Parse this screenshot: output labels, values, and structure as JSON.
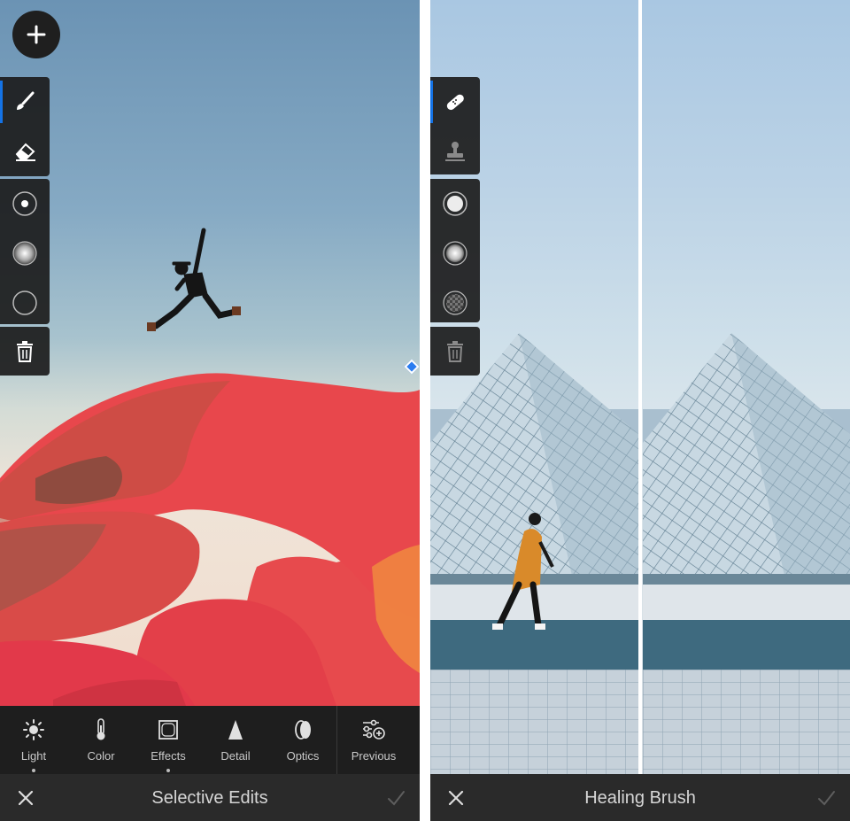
{
  "left_screen": {
    "add_button": "add",
    "brush_tools": [
      {
        "icon": "brush-icon",
        "active": true
      },
      {
        "icon": "eraser-icon",
        "active": false
      }
    ],
    "brush_sizes": [
      {
        "icon": "size-small-icon"
      },
      {
        "icon": "size-feather-icon"
      },
      {
        "icon": "size-empty-icon"
      }
    ],
    "delete": "trash-icon",
    "tabs": [
      {
        "label": "Light",
        "icon": "sun-icon",
        "has_dot": true
      },
      {
        "label": "Color",
        "icon": "thermometer-icon",
        "has_dot": false
      },
      {
        "label": "Effects",
        "icon": "effects-frame-icon",
        "has_dot": true
      },
      {
        "label": "Detail",
        "icon": "detail-triangle-icon",
        "has_dot": false
      },
      {
        "label": "Optics",
        "icon": "optics-lens-icon",
        "has_dot": false
      },
      {
        "label": "Previous",
        "icon": "sliders-plus-icon",
        "has_dot": false
      }
    ],
    "title": "Selective Edits"
  },
  "right_screen": {
    "heal_tools": [
      {
        "icon": "bandage-icon",
        "active": true
      },
      {
        "icon": "stamp-icon",
        "active": false
      }
    ],
    "brush_sizes": [
      {
        "icon": "size-solid-icon"
      },
      {
        "icon": "size-feather-icon"
      },
      {
        "icon": "size-opacity-icon"
      }
    ],
    "delete": "trash-icon",
    "title": "Healing Brush"
  },
  "colors": {
    "accent": "#1473e6",
    "toolbar_bg": "#1e1e1e",
    "title_bg": "#2a2a2a",
    "text": "#d6d6d6"
  }
}
